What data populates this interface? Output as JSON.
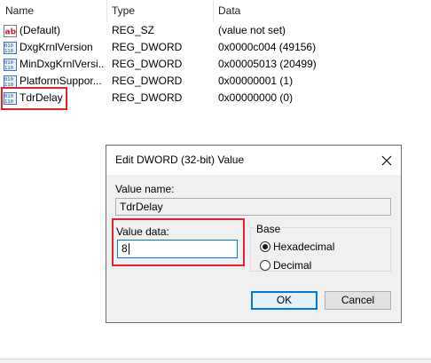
{
  "columns": {
    "name": "Name",
    "type": "Type",
    "data": "Data"
  },
  "rows": [
    {
      "name": "(Default)",
      "type": "REG_SZ",
      "data": "(value not set)",
      "icon": "string-value-icon"
    },
    {
      "name": "DxgKrnlVersion",
      "type": "REG_DWORD",
      "data": "0x0000c004 (49156)",
      "icon": "binary-value-icon"
    },
    {
      "name": "MinDxgKrnlVersi...",
      "type": "REG_DWORD",
      "data": "0x00005013 (20499)",
      "icon": "binary-value-icon"
    },
    {
      "name": "PlatformSuppor...",
      "type": "REG_DWORD",
      "data": "0x00000001 (1)",
      "icon": "binary-value-icon"
    },
    {
      "name": "TdrDelay",
      "type": "REG_DWORD",
      "data": "0x00000000 (0)",
      "icon": "binary-value-icon"
    }
  ],
  "dialog": {
    "title": "Edit DWORD (32-bit) Value",
    "value_name_label": "Value name:",
    "value_name": "TdrDelay",
    "value_data_label": "Value data:",
    "value_data": "8",
    "base_label": "Base",
    "base_options": [
      {
        "label": "Hexadecimal",
        "checked": true
      },
      {
        "label": "Decimal",
        "checked": false
      }
    ],
    "ok_label": "OK",
    "cancel_label": "Cancel"
  },
  "colors": {
    "highlight": "#e0212f",
    "focus": "#0078d7",
    "dialog_bg": "#f0f0f0"
  }
}
